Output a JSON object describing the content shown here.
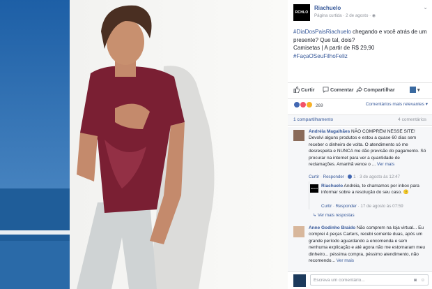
{
  "page": {
    "name": "Riachuelo",
    "logo_text": "RCHLO",
    "meta_type": "Página curtida",
    "date": "2 de agosto",
    "options_icon": "chevron-down-icon"
  },
  "post": {
    "hashtag1": "#DiaDosPaisRiachuelo",
    "text1": " chegando e você atrás de um presente? Que tal, dois?",
    "text2": "Camisetas | A partir de R$ 29,90",
    "hashtag2": "#FaçaOSeuFilhoFeliz"
  },
  "actions": {
    "like": "Curtir",
    "comment": "Comentar",
    "share": "Compartilhar"
  },
  "reactions": {
    "count": "269",
    "sort_label": "Comentários mais relevantes",
    "like_color": "#4267b2",
    "love_color": "#f25268",
    "haha_color": "#f7b125"
  },
  "stats": {
    "shares": "1 compartilhamento",
    "comments": "4 comentários"
  },
  "comments": [
    {
      "author": "Andréia Magalhães",
      "text": " NÃO COMPREM NESSE SITE! Devolvi alguns produtos e estou a quase 60 dias sem receber o dinheiro de volta. O atendimento só me desrespeita e NUNCA me dão previsão do pagamento. Só procurar na internet para ver a quantidade de reclamações. Amanhã vence o ...",
      "more": "Ver mais",
      "like": "Curtir",
      "reply": "Responder",
      "reactions": "1",
      "date": "3 de agosto às 12:47"
    },
    {
      "author": "Riachuelo",
      "text": " Andréia, te chamamos por inbox para informar sobre a resolução do seu caso. 🙂",
      "like": "Curtir",
      "reply": "Responder",
      "date": "17 de agosto às 07:59"
    },
    {
      "author": "Anne Godinho Braido",
      "text": " Não comprem na loja virtual... Eu comprei 4 peças Carters, recebi somente duas, após um grande período aguardando a encomenda e sem nenhuma explicação e até agora não me estornaram meu dinheiro... péssima compra, péssimo atendimento, não recomendo...",
      "more": "Ver mais"
    }
  ],
  "more_replies": "Ver mais respostas",
  "compose": {
    "placeholder": "Escreva um comentário..."
  }
}
